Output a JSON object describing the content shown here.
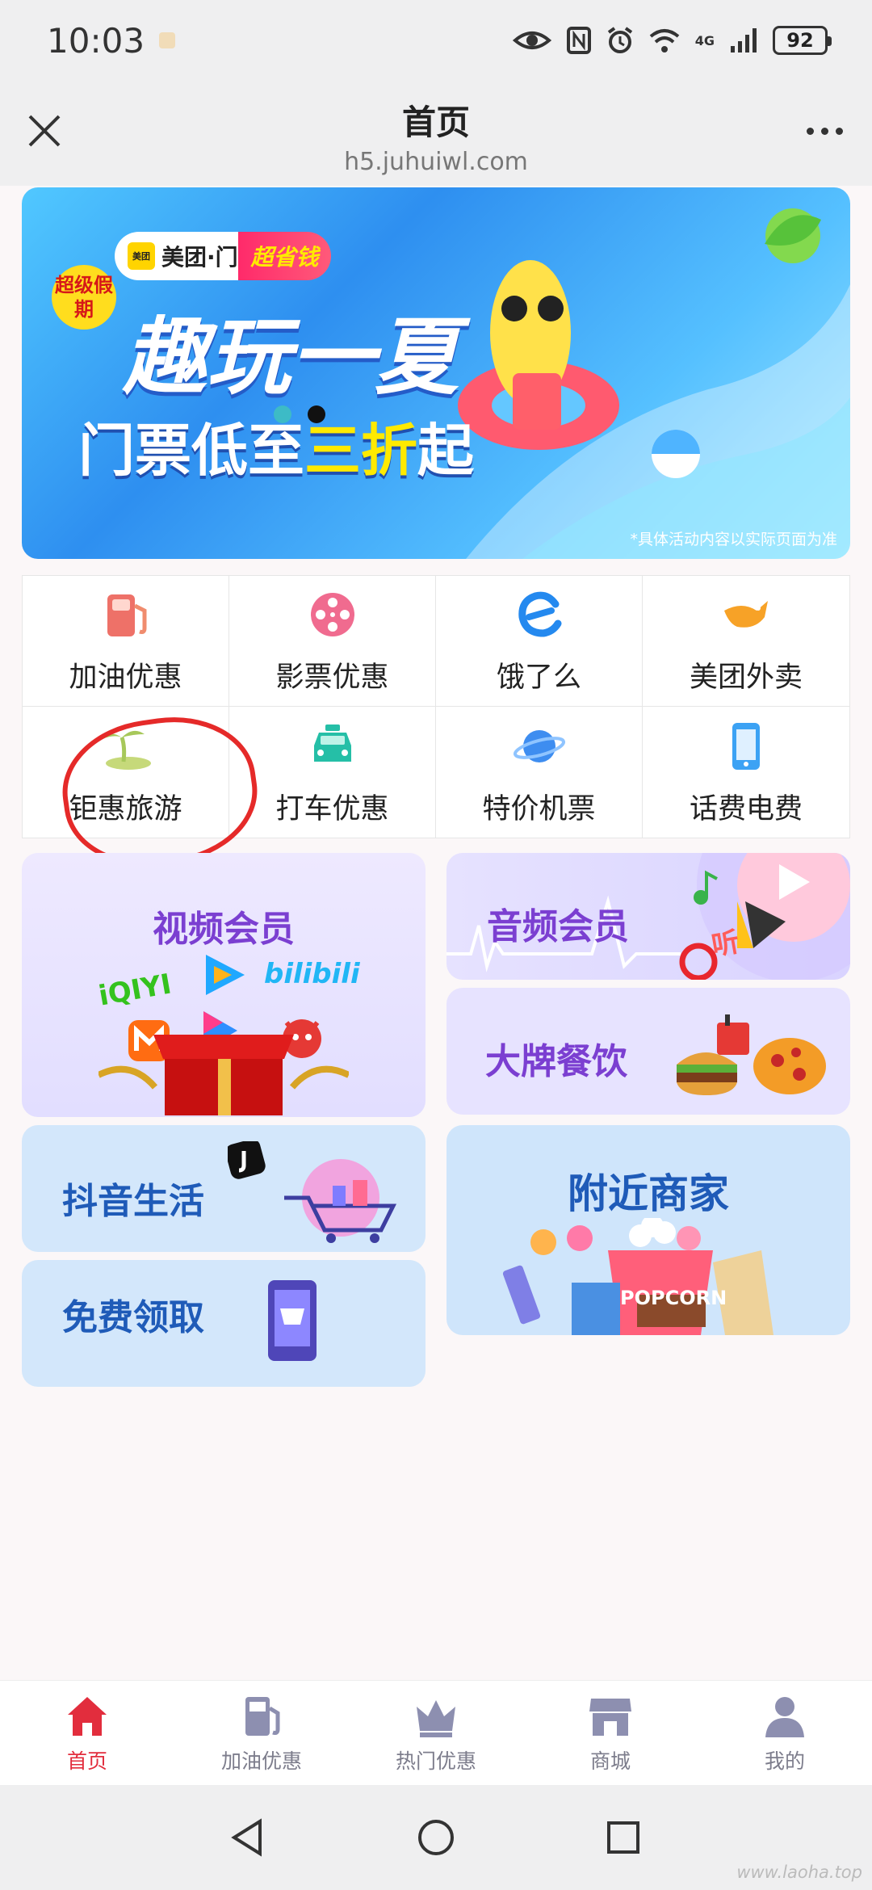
{
  "status_bar": {
    "time": "10:03",
    "network": "4G",
    "battery": "92"
  },
  "header": {
    "title": "首页",
    "url": "h5.juhuiwl.com"
  },
  "banner": {
    "brand": "美团·门票",
    "brand_tag": "超省钱",
    "badge": "超级假期",
    "title": "趣玩一夏",
    "subtitle_prefix": "门票低至",
    "subtitle_highlight": "三折",
    "subtitle_suffix": "起",
    "note": "*具体活动内容以实际页面为准",
    "active_slide": 2,
    "slide_count": 2
  },
  "services": [
    {
      "label": "加油优惠",
      "icon": "gas-pump-icon",
      "color": "#ee7168"
    },
    {
      "label": "影票优惠",
      "icon": "film-reel-icon",
      "color": "#f06b8f"
    },
    {
      "label": "饿了么",
      "icon": "eleme-logo-icon",
      "color": "#2489ef"
    },
    {
      "label": "美团外卖",
      "icon": "kangaroo-icon",
      "color": "#f7a227"
    },
    {
      "label": "钜惠旅游",
      "icon": "palm-island-icon",
      "color": "#a7c85a"
    },
    {
      "label": "打车优惠",
      "icon": "taxi-icon",
      "color": "#25bfa7"
    },
    {
      "label": "特价机票",
      "icon": "planet-icon",
      "color": "#3e8df0"
    },
    {
      "label": "话费电费",
      "icon": "phone-icon",
      "color": "#3ca2f4"
    }
  ],
  "cards": {
    "video": {
      "title": "视频会员",
      "brands": [
        "iQIYI",
        "bilibili"
      ]
    },
    "audio": {
      "title": "音频会员",
      "tag": "听"
    },
    "food": {
      "title": "大牌餐饮"
    },
    "douyin": {
      "title": "抖音生活"
    },
    "nearby": {
      "title": "附近商家",
      "snack": "POPCORN"
    },
    "free": {
      "title": "免费领取"
    }
  },
  "bottom_nav": [
    {
      "label": "首页",
      "icon": "home-icon",
      "active": true
    },
    {
      "label": "加油优惠",
      "icon": "gas-pump-icon",
      "active": false
    },
    {
      "label": "热门优惠",
      "icon": "crown-icon",
      "active": false
    },
    {
      "label": "商城",
      "icon": "store-icon",
      "active": false
    },
    {
      "label": "我的",
      "icon": "user-icon",
      "active": false
    }
  ],
  "watermark": "www.laoha.top",
  "colors": {
    "accent": "#e22d3d",
    "card_title_purple": "#7b3fd1",
    "card_title_blue": "#1f5bb8"
  }
}
